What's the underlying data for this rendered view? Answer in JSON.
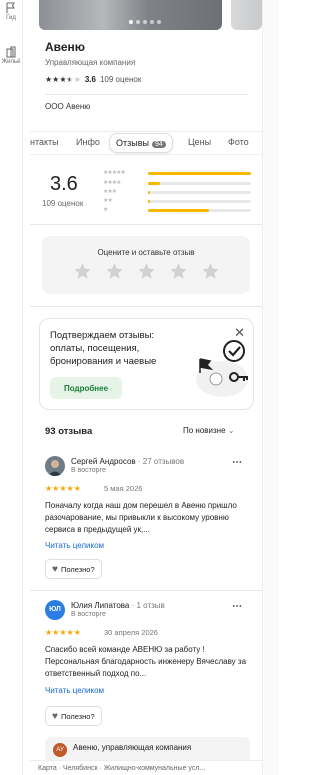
{
  "left_rail": {
    "items": [
      {
        "label": "Гид",
        "icon": "flag-icon"
      },
      {
        "label": "Жильё",
        "icon": "building-icon"
      }
    ]
  },
  "header": {
    "title": "Авеню",
    "subtitle": "Управляющая компания",
    "rating": "3.6",
    "rating_fraction": 0.72,
    "reviews_count": "109 оценок",
    "company_name": "ООО Авеню"
  },
  "tabs": [
    {
      "label": "нтакты",
      "active": false
    },
    {
      "label": "Инфо",
      "active": false
    },
    {
      "label": "Отзывы",
      "active": true,
      "badge": "94"
    },
    {
      "label": "Цены",
      "active": false
    },
    {
      "label": "Фото",
      "active": false
    }
  ],
  "rating_summary": {
    "score": "3.6",
    "count_label": "109 оценок",
    "histogram": [
      {
        "stars": 5,
        "fraction": 1.0
      },
      {
        "stars": 4,
        "fraction": 0.12
      },
      {
        "stars": 3,
        "fraction": 0.02
      },
      {
        "stars": 2,
        "fraction": 0.02
      },
      {
        "stars": 1,
        "fraction": 0.59
      }
    ]
  },
  "rate_box": {
    "label": "Оцените и оставьте отзыв"
  },
  "promo": {
    "text": "Подтверждаем отзывы: оплаты, посещения, бронирования и чаевые",
    "button": "Подробнее",
    "close": "✕"
  },
  "reviews_section": {
    "count": "93 отзыва",
    "sort": "По новизне"
  },
  "reviews": [
    {
      "name": "Сергей Андросов",
      "reviews_count": "· 27 отзывов",
      "level": "В восторге",
      "date": "5 мая 2026",
      "rating": 5,
      "text": "Поначалу когда наш дом перешел в Авеню пришло разочарование, мы привыкли к высокому уровню сервиса в предыдущей ук,...",
      "more": "Читать целиком",
      "useful": "Полезно?"
    },
    {
      "name": "Юлия Липатова",
      "initials": "ЮЛ",
      "reviews_count": "· 1 отзыв",
      "level": "В восторге",
      "date": "30 апреля 2026",
      "rating": 5,
      "text": "Спасибо всей команде АВЕНЮ за работу ! Персональная благодарность инженеру Вячеславу за ответственный подход по...",
      "more": "Читать целиком",
      "useful": "Полезно?"
    }
  ],
  "org_reply": {
    "initials": "АУ",
    "name": "Авеню, управляющая компания"
  },
  "footer": {
    "breadcrumb": "Карта · Челябинск · Жилищно-коммунальные усл..."
  },
  "colors": {
    "star": "#f5a700",
    "bar": "#f5b700",
    "link": "#1967d2",
    "promo_button": "#1a7f37"
  }
}
